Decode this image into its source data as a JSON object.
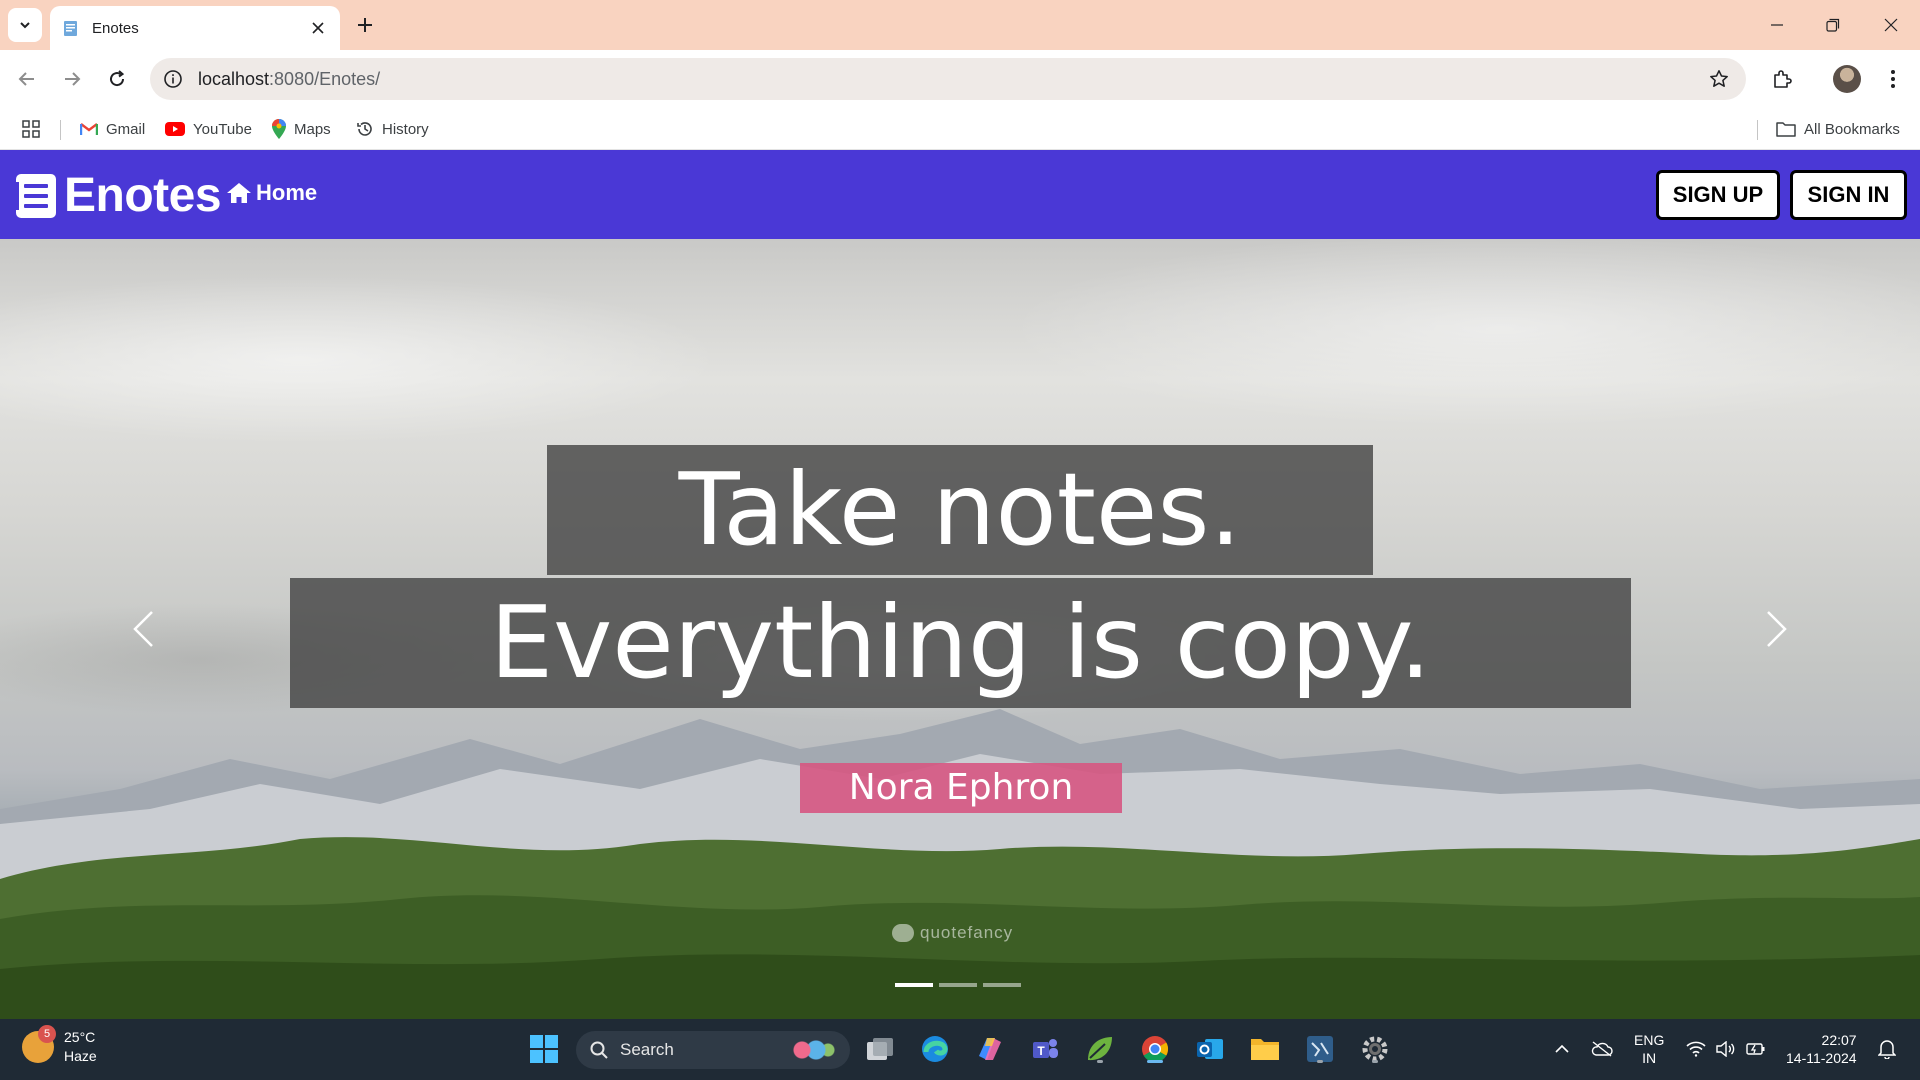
{
  "browser": {
    "tab": {
      "title": "Enotes"
    },
    "url": {
      "host": "localhost",
      "path": ":8080/Enotes/"
    },
    "bookmarks": [
      {
        "label": "Gmail",
        "icon": "gmail-icon"
      },
      {
        "label": "YouTube",
        "icon": "youtube-icon"
      },
      {
        "label": "Maps",
        "icon": "maps-icon"
      },
      {
        "label": "History",
        "icon": "history-icon"
      }
    ],
    "all_bookmarks_label": "All Bookmarks"
  },
  "site": {
    "brand": "Enotes",
    "nav": {
      "home_label": "Home"
    },
    "buttons": {
      "signup_label": "SIGN UP",
      "signin_label": "SIGN IN"
    },
    "colors": {
      "navbar": "#4a38d6",
      "author_bg": "#d65682"
    }
  },
  "hero": {
    "quote_line1": "Take notes.",
    "quote_line2": "Everything is copy.",
    "author": "Nora Ephron",
    "watermark": "quotefancy",
    "slide_count": 3,
    "active_slide": 1
  },
  "taskbar": {
    "weather": {
      "temp": "25°C",
      "condition": "Haze",
      "badge": "5"
    },
    "search_label": "Search",
    "lang": {
      "line1": "ENG",
      "line2": "IN"
    },
    "clock": {
      "time": "22:07",
      "date": "14-11-2024"
    }
  }
}
